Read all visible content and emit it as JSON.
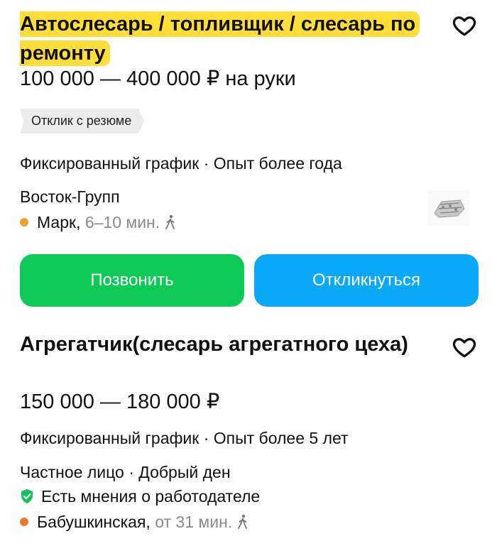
{
  "colors": {
    "highlight": "#ffde3a",
    "call_button": "#0dc956",
    "apply_button": "#0aa9f8",
    "metro_orange": "#f0a030",
    "metro_orange2": "#f07830",
    "verified_green": "#16c05a"
  },
  "vacancies": [
    {
      "title": "Автослесарь / топливщик / слесарь по ремонту",
      "title_highlighted": true,
      "salary": "100 000 — 400 000 ₽ на руки",
      "chip": "Отклик с резюме",
      "schedule": "Фиксированный график · Опыт более года",
      "company": "Восток-Групп",
      "metro": {
        "station": "Марк,",
        "time": "6–10 мин.",
        "icon": "walk-icon"
      },
      "logo": "company-logo",
      "buttons": {
        "call": "Позвонить",
        "apply": "Откликнуться"
      },
      "favorite_icon": "heart-icon"
    },
    {
      "title": "Агрегатчик(слесарь агрегатного цеха)",
      "title_highlighted": false,
      "salary": "150 000 — 180 000 ₽",
      "schedule": "Фиксированный график · Опыт более 5 лет",
      "company": "Частное лицо · Добрый ден",
      "employer_reviews": "Есть мнения о работодателе",
      "metro": {
        "station": "Бабушкинская,",
        "time": "от 31 мин.",
        "icon": "walk-icon"
      },
      "favorite_icon": "heart-icon"
    }
  ]
}
